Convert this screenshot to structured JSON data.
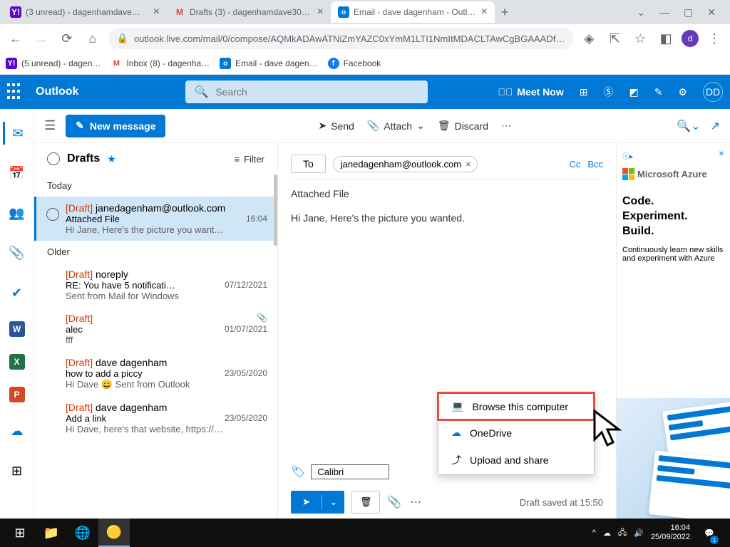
{
  "browser": {
    "tabs": [
      {
        "label": "(3 unread) - dagenhamdave@ya",
        "active": false,
        "favicon": "y"
      },
      {
        "label": "Drafts (3) - dagenhamdave30@g",
        "active": false,
        "favicon": "m"
      },
      {
        "label": "Email - dave dagenham - Outlook",
        "active": true,
        "favicon": "o"
      }
    ],
    "url": "outlook.live.com/mail/0/compose/AQMkADAwATNiZmYAZC0xYmM1LTI1NmItMDACLTAwCgBGAAADf…",
    "avatar_letter": "d",
    "bookmarks": [
      {
        "label": "(5 unread) - dagen…",
        "favicon": "y"
      },
      {
        "label": "Inbox (8) - dagenha…",
        "favicon": "m"
      },
      {
        "label": "Email - dave dagen…",
        "favicon": "o"
      },
      {
        "label": "Facebook",
        "favicon": "f"
      }
    ]
  },
  "owa": {
    "brand": "Outlook",
    "search_placeholder": "Search",
    "meet_now": "Meet Now",
    "avatar": "DD"
  },
  "toolbar": {
    "new_message": "New message",
    "send": "Send",
    "attach": "Attach",
    "discard": "Discard"
  },
  "list": {
    "folder": "Drafts",
    "filter": "Filter",
    "sections": {
      "today": "Today",
      "older": "Older"
    },
    "items": [
      {
        "draft": "[Draft]",
        "from": "janedagenham@outlook.com",
        "subject": "Attached File",
        "time": "16:04",
        "preview": "Hi Jane, Here's the picture you want…",
        "attach": false,
        "selected": true,
        "section": "today"
      },
      {
        "draft": "[Draft]",
        "from": "noreply",
        "subject": "RE: You have 5 notificati…",
        "time": "07/12/2021",
        "preview": "Sent from Mail for Windows",
        "attach": false,
        "selected": false,
        "section": "older"
      },
      {
        "draft": "[Draft]",
        "from": "",
        "subject": "alec",
        "time": "01/07/2021",
        "preview": "fff",
        "attach": true,
        "selected": false,
        "section": "older"
      },
      {
        "draft": "[Draft]",
        "from": "dave dagenham",
        "subject": "how to add a piccy",
        "time": "23/05/2020",
        "preview": "Hi Dave 😄 Sent from Outlook",
        "attach": false,
        "selected": false,
        "section": "older"
      },
      {
        "draft": "[Draft]",
        "from": "dave dagenham",
        "subject": "Add a link",
        "time": "23/05/2020",
        "preview": "Hi Dave, here's that website, https://…",
        "attach": false,
        "selected": false,
        "section": "older"
      }
    ]
  },
  "compose": {
    "to_label": "To",
    "recipient": "janedagenham@outlook.com",
    "cc": "Cc",
    "bcc": "Bcc",
    "subject": "Attached File",
    "body": "Hi Jane, Here's the picture you wanted.",
    "font": "Calibri",
    "draft_saved": "Draft saved at 15:50"
  },
  "attach_menu": {
    "browse": "Browse this computer",
    "onedrive": "OneDrive",
    "upload": "Upload and share"
  },
  "ad": {
    "brand": "Microsoft Azure",
    "headline_l1": "Code.",
    "headline_l2": "Experiment.",
    "headline_l3": "Build.",
    "sub": "Continuously learn new skills and experiment with Azure"
  },
  "taskbar": {
    "time": "16:04",
    "date": "25/09/2022",
    "notif_count": "1"
  }
}
